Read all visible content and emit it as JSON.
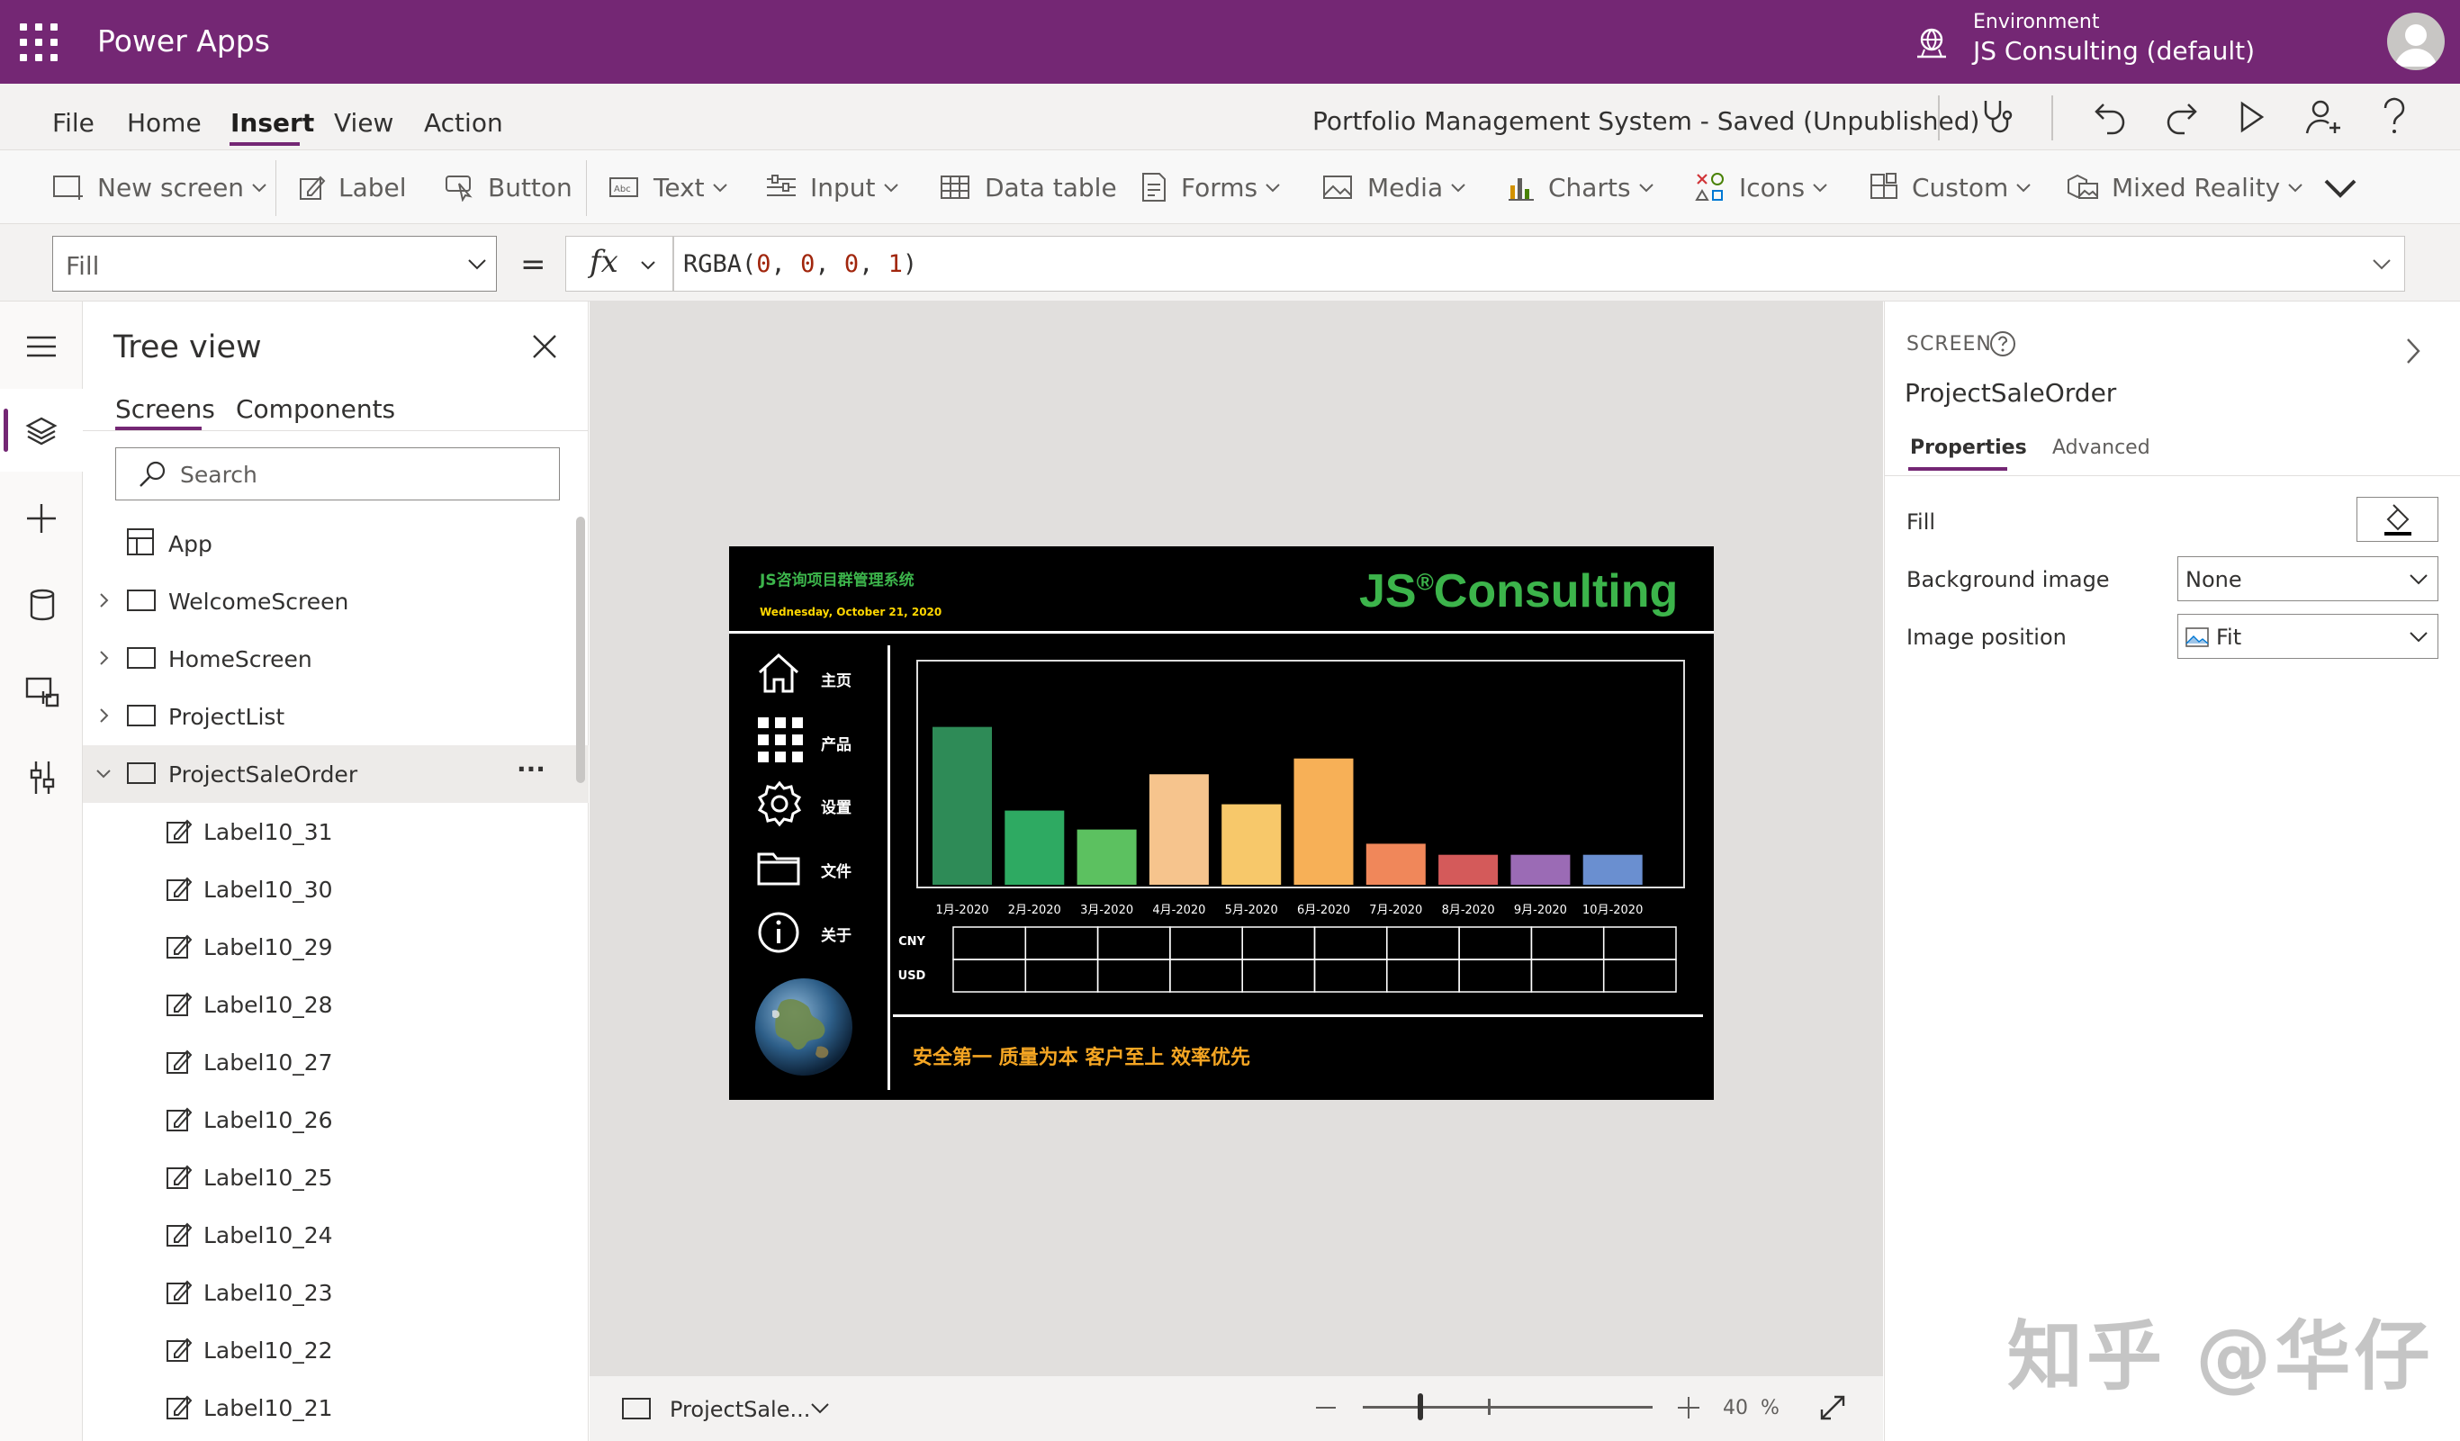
{
  "topbar": {
    "app_name": "Power Apps",
    "env_label": "Environment",
    "env_name": "JS Consulting (default)"
  },
  "menubar": {
    "items": [
      "File",
      "Home",
      "Insert",
      "View",
      "Action"
    ],
    "active": "Insert",
    "doc_title": "Portfolio Management System - Saved (Unpublished)"
  },
  "ribbon": {
    "new_screen": "New screen",
    "label": "Label",
    "button": "Button",
    "text": "Text",
    "input": "Input",
    "data_table": "Data table",
    "forms": "Forms",
    "media": "Media",
    "charts": "Charts",
    "icons": "Icons",
    "custom": "Custom",
    "mixed_reality": "Mixed Reality"
  },
  "formula": {
    "property": "Fill",
    "equals": "=",
    "fx": "fx",
    "fn": "RGBA(",
    "args": [
      "0",
      "0",
      "0",
      "1"
    ],
    "close": ")"
  },
  "tree": {
    "title": "Tree view",
    "tabs": [
      "Screens",
      "Components"
    ],
    "search_placeholder": "Search",
    "app": "App",
    "screens": [
      "WelcomeScreen",
      "HomeScreen",
      "ProjectList",
      "ProjectSaleOrder"
    ],
    "selected_more": "···",
    "children": [
      "Label10_31",
      "Label10_30",
      "Label10_29",
      "Label10_28",
      "Label10_27",
      "Label10_26",
      "Label10_25",
      "Label10_24",
      "Label10_23",
      "Label10_22",
      "Label10_21"
    ]
  },
  "app_screen": {
    "system_title": "JS咨询项目群管理系统",
    "date": "Wednesday, October 21, 2020",
    "logo_js": "JS",
    "logo_reg": "®",
    "logo_consulting": "Consulting",
    "nav": [
      "主页",
      "产品",
      "设置",
      "文件",
      "关于"
    ],
    "row_labels": [
      "CNY",
      "USD"
    ],
    "slogan": "安全第一  质量为本  客户至上  效率优先",
    "colors": {
      "title": "#3cb44b",
      "date": "#ffd700",
      "slogan": "#f5a623"
    }
  },
  "chart_data": {
    "type": "bar",
    "categories": [
      "1月-2020",
      "2月-2020",
      "3月-2020",
      "4月-2020",
      "5月-2020",
      "6月-2020",
      "7月-2020",
      "8月-2020",
      "9月-2020",
      "10月-2020"
    ],
    "values": [
      100,
      47,
      35,
      70,
      51,
      80,
      26,
      19,
      19,
      19
    ],
    "ylim": [
      0,
      138
    ],
    "colors": [
      "#2e8b57",
      "#2eaa62",
      "#5cc160",
      "#f6c48d",
      "#f7c86a",
      "#f7b057",
      "#f0875a",
      "#d45a5a",
      "#9b6bb5",
      "#6a8fd0"
    ],
    "grid": false,
    "legend": "none"
  },
  "bottombar": {
    "screen_name": "ProjectSale...",
    "zoom": "40",
    "zoom_unit": "%",
    "zoom_fraction": 0.2
  },
  "rightpane": {
    "kind": "SCREEN",
    "name": "ProjectSaleOrder",
    "tabs": [
      "Properties",
      "Advanced"
    ],
    "fill_label": "Fill",
    "bg_image_label": "Background image",
    "bg_image_value": "None",
    "image_position_label": "Image position",
    "image_position_value": "Fit"
  },
  "watermark": "知乎 @华仔"
}
